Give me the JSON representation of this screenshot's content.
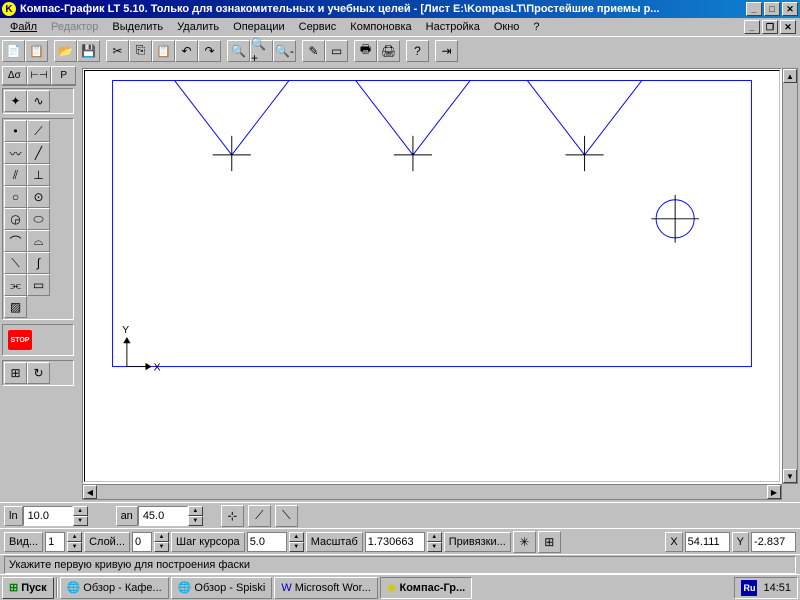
{
  "title": "Компас-График LT 5.10. Только для ознакомительных и учебных целей - [Лист E:\\KompasLT\\Простейшие приемы р...",
  "menu": {
    "file": "Файл",
    "edit": "Редактор",
    "select": "Выделить",
    "delete": "Удалить",
    "ops": "Операции",
    "service": "Сервис",
    "layout": "Компоновка",
    "settings": "Настройка",
    "window": "Окно",
    "help": "?"
  },
  "side_tabs": {
    "a": "Δσ",
    "b": "⊢⊣",
    "c": "P"
  },
  "side_stop": "STOP",
  "param": {
    "ln_label": "ln",
    "ln_value": "10.0",
    "an_label": "an",
    "an_value": "45.0"
  },
  "opts": {
    "vid": "Вид...",
    "vid_val": "1",
    "sloi": "Слой...",
    "sloi_val": "0",
    "shag": "Шаг курсора",
    "shag_val": "5.0",
    "mashtab": "Масштаб",
    "mashtab_val": "1.730663",
    "priv": "Привязки...",
    "x_label": "X",
    "x_val": "54.111",
    "y_label": "Y",
    "y_val": "-2.837"
  },
  "status": "Укажите первую кривую для построения фаски",
  "taskbar": {
    "start": "Пуск",
    "t1": "Обзор - Кафе...",
    "t2": "Обзор - Spiski",
    "t3": "Microsoft Wor...",
    "t4": "Компас-Гр...",
    "lang": "Ru",
    "time": "14:51"
  },
  "axes": {
    "x": "X",
    "y": "Y"
  }
}
